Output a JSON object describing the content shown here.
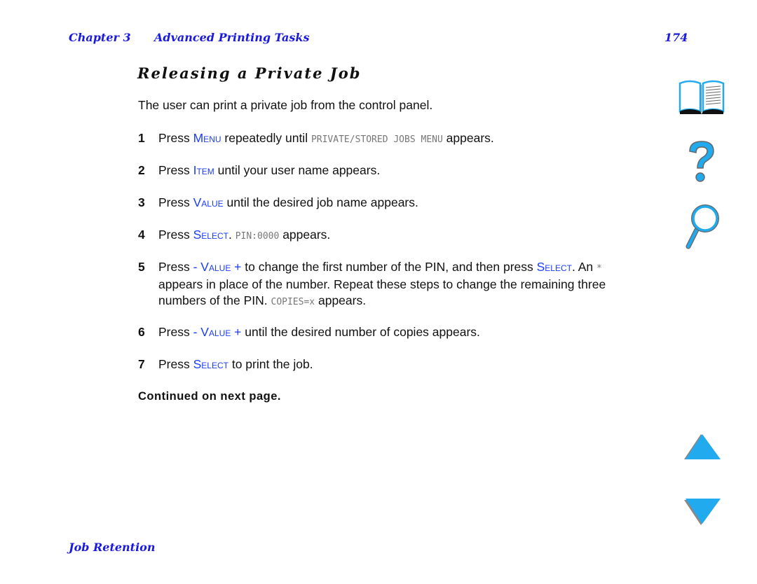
{
  "header": {
    "chapter": "Chapter 3",
    "chapter_title": "Advanced Printing Tasks",
    "page_number": "174"
  },
  "section_title": "Releasing a Private Job",
  "intro": "The user can print a private job from the control panel.",
  "steps": [
    {
      "num": "1",
      "parts": [
        {
          "t": "Press "
        },
        {
          "k": "Menu"
        },
        {
          "t": " repeatedly until "
        },
        {
          "l": "PRIVATE/STORED JOBS MENU"
        },
        {
          "t": " appears."
        }
      ]
    },
    {
      "num": "2",
      "parts": [
        {
          "t": "Press "
        },
        {
          "k": "Item"
        },
        {
          "t": " until your user name appears."
        }
      ]
    },
    {
      "num": "3",
      "parts": [
        {
          "t": "Press "
        },
        {
          "k": "Value"
        },
        {
          "t": " until the desired job name appears."
        }
      ]
    },
    {
      "num": "4",
      "parts": [
        {
          "t": "Press "
        },
        {
          "k": "Select"
        },
        {
          "t": ". "
        },
        {
          "l": "PIN:0000"
        },
        {
          "t": " appears."
        }
      ]
    },
    {
      "num": "5",
      "parts": [
        {
          "t": "Press "
        },
        {
          "k": "- Value +"
        },
        {
          "t": " to change the first number of the PIN, and then press "
        },
        {
          "k": "Select"
        },
        {
          "t": ". An "
        },
        {
          "l": "*"
        },
        {
          "t": " appears in place of the number. Repeat these steps to change the remaining three numbers of the PIN. "
        },
        {
          "l": "COPIES=x"
        },
        {
          "t": " appears."
        }
      ]
    },
    {
      "num": "6",
      "parts": [
        {
          "t": "Press "
        },
        {
          "k": "- Value +"
        },
        {
          "t": " until the desired number of copies appears."
        }
      ]
    },
    {
      "num": "7",
      "parts": [
        {
          "t": "Press "
        },
        {
          "k": "Select"
        },
        {
          "t": " to print the job."
        }
      ]
    }
  ],
  "continued": "Continued on next page.",
  "footer": "Job Retention",
  "nav_icons": [
    "book-icon",
    "help-icon",
    "search-icon",
    "previous-page-icon",
    "next-page-icon"
  ],
  "colors": {
    "link": "#1a1adf",
    "key": "#1a3cff",
    "icon": "#22aaee"
  }
}
